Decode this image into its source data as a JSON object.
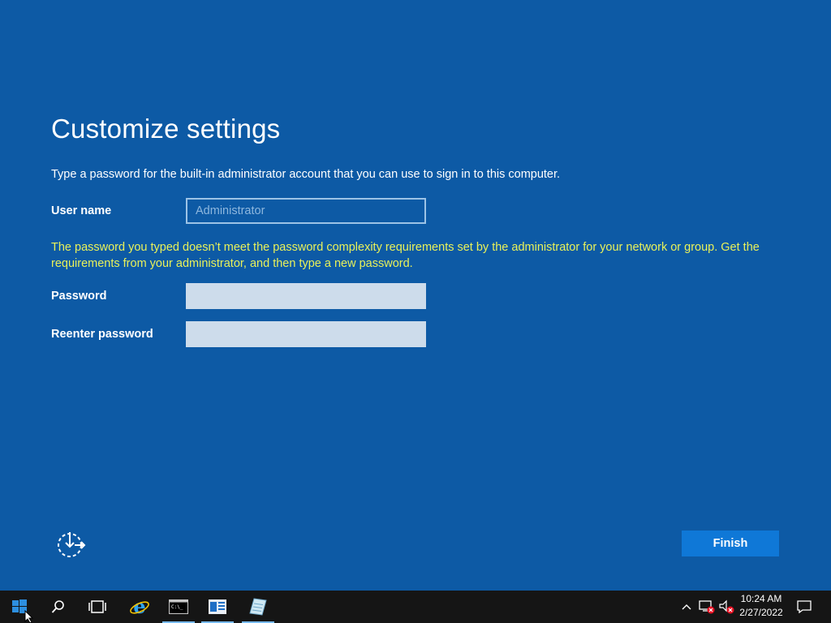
{
  "setup": {
    "title": "Customize settings",
    "instruction": "Type a password for the built-in administrator account that you can use to sign in to this computer.",
    "username_label": "User name",
    "username_placeholder": "Administrator",
    "error_message": "The password you typed doesn’t meet the password complexity requirements set by the administrator for your network or group. Get the requirements from your administrator, and then type a new password.",
    "password_label": "Password",
    "password_value": "",
    "reenter_label": "Reenter password",
    "reenter_value": "",
    "finish_label": "Finish",
    "accessibility_icon": "ease-of-access-icon"
  },
  "taskbar": {
    "items": [
      {
        "name": "start-icon"
      },
      {
        "name": "search-icon"
      },
      {
        "name": "task-view-icon"
      },
      {
        "name": "internet-explorer-icon"
      },
      {
        "name": "command-prompt-icon"
      },
      {
        "name": "server-manager-icon"
      },
      {
        "name": "notepad-icon"
      }
    ],
    "tray": {
      "chevron": "chevron-up-icon",
      "network": "network-disconnected-icon",
      "volume": "volume-muted-icon",
      "notifications": "action-center-icon"
    },
    "time": "10:24 AM",
    "date": "2/27/2022"
  },
  "colors": {
    "background": "#0d5aa5",
    "error_text": "#e8f15a",
    "finish_button": "#0f78d7",
    "taskbar": "#151515",
    "field_fill": "#cddceb"
  }
}
